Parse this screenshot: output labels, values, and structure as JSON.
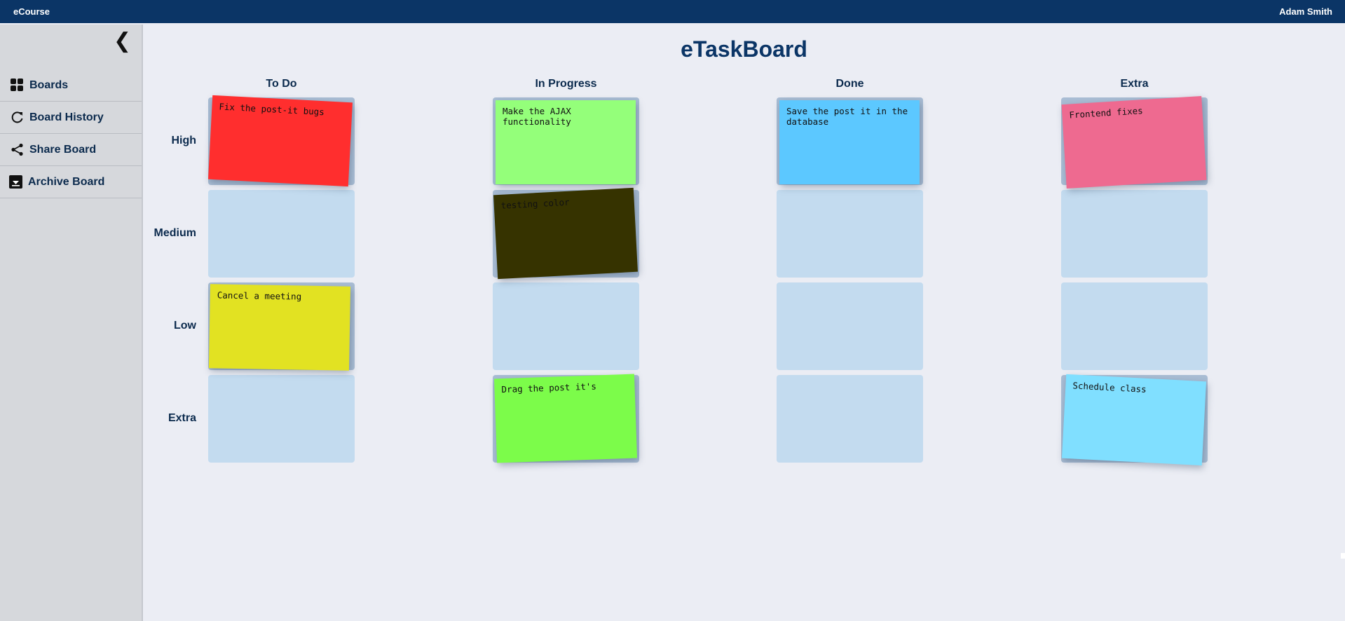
{
  "header": {
    "brand": "eCourse",
    "user": "Adam Smith"
  },
  "sidebar": {
    "collapse_glyph": "❮",
    "items": [
      {
        "label": "Boards",
        "icon": "grid-icon"
      },
      {
        "label": "Board History",
        "icon": "history-icon"
      },
      {
        "label": "Share Board",
        "icon": "share-icon"
      },
      {
        "label": "Archive Board",
        "icon": "archive-icon"
      }
    ]
  },
  "board": {
    "title": "eTaskBoard",
    "columns": [
      "To Do",
      "In Progress",
      "Done",
      "Extra"
    ],
    "rows": [
      "High",
      "Medium",
      "Low",
      "Extra"
    ],
    "notes": [
      {
        "text": "Fix the post-it bugs",
        "column": "To Do",
        "row": "High",
        "color": "#ff2e2e"
      },
      {
        "text": "Make the AJAX functionality",
        "column": "In Progress",
        "row": "High",
        "color": "#94ff7a"
      },
      {
        "text": "Save the post it in the database",
        "column": "Done",
        "row": "High",
        "color": "#5cc8ff"
      },
      {
        "text": "Frontend fixes",
        "column": "Extra",
        "row": "High",
        "color": "#ee6a90"
      },
      {
        "text": "testing color",
        "column": "In Progress",
        "row": "Medium",
        "color": "#363300"
      },
      {
        "text": "Cancel a meeting",
        "column": "To Do",
        "row": "Low",
        "color": "#e2e222"
      },
      {
        "text": "Drag the post it's",
        "column": "In Progress",
        "row": "Extra",
        "color": "#7cfc4a"
      },
      {
        "text": "Schedule class",
        "column": "Extra",
        "row": "Extra",
        "color": "#80dfff"
      }
    ]
  }
}
